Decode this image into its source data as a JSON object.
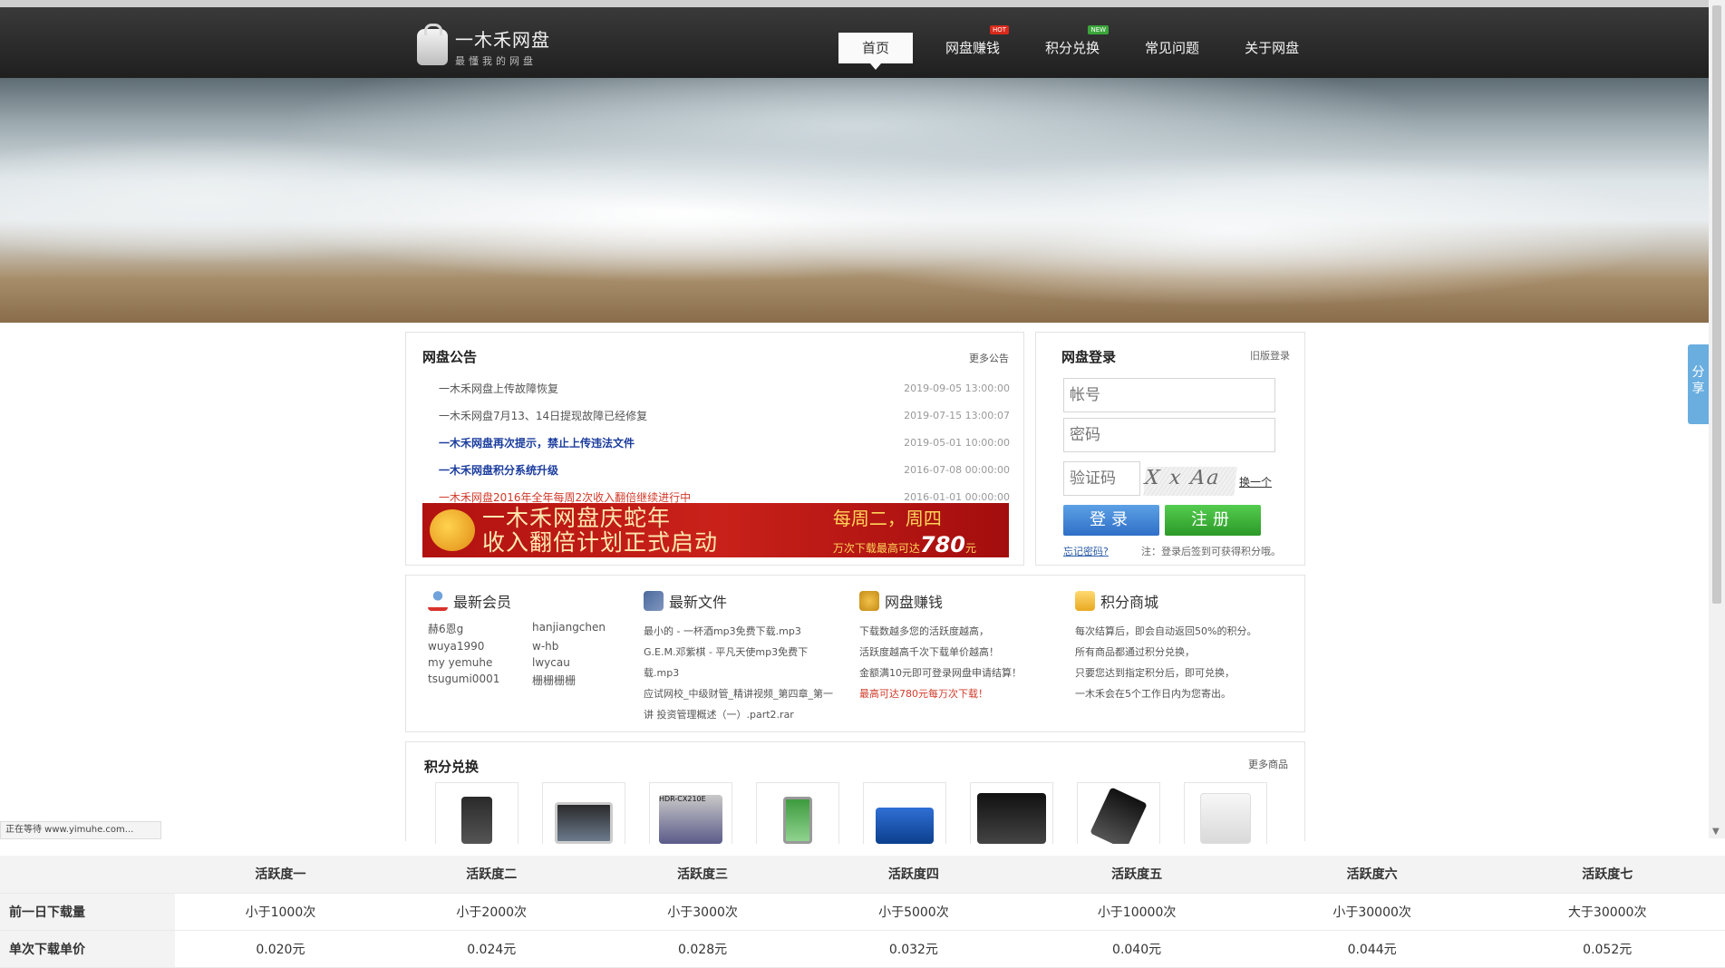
{
  "header": {
    "logo_title": "一木禾网盘",
    "logo_subtitle": "最懂我的网盘",
    "nav": [
      {
        "label": "首页",
        "active": true,
        "badge": ""
      },
      {
        "label": "网盘赚钱",
        "active": false,
        "badge": "HOT"
      },
      {
        "label": "积分兑换",
        "active": false,
        "badge": "NEW"
      },
      {
        "label": "常见问题",
        "active": false,
        "badge": ""
      },
      {
        "label": "关于网盘",
        "active": false,
        "badge": ""
      }
    ]
  },
  "share_tab": "分享",
  "notice": {
    "title": "网盘公告",
    "more": "更多公告",
    "items": [
      {
        "text": "一木禾网盘上传故障恢复",
        "date": "2019-09-05 13:00:00",
        "style": "gray"
      },
      {
        "text": "一木禾网盘7月13、14日提现故障已经修复",
        "date": "2019-07-15 13:00:07",
        "style": "gray"
      },
      {
        "text": "一木禾网盘再次提示，禁止上传违法文件",
        "date": "2019-05-01 10:00:00",
        "style": "blue"
      },
      {
        "text": "一木禾网盘积分系统升级",
        "date": "2016-07-08 00:00:00",
        "style": "blue"
      },
      {
        "text": "一木禾网盘2016年全年每周2次收入翻倍继续进行中",
        "date": "2016-01-01 00:00:00",
        "style": "red"
      }
    ],
    "promo_main_line1": "一木禾网盘庆蛇年",
    "promo_main_line2": "收入翻倍计划正式启动",
    "promo_side_line1": "每周二，周四",
    "promo_side_line2": "万次下载最高可达",
    "promo_amount": "780",
    "promo_unit": "元"
  },
  "login": {
    "title": "网盘登录",
    "old_login": "旧版登录",
    "account_placeholder": "帐号",
    "password_placeholder": "密码",
    "captcha_placeholder": "验证码",
    "captcha_text": "X x Aa",
    "captcha_refresh": "换一个",
    "login_button": "登录",
    "register_button": "注册",
    "forgot": "忘记密码?",
    "note": "注：登录后签到可获得积分哦。"
  },
  "info": {
    "members": {
      "title": "最新会员",
      "names": [
        "赫6恩g",
        "hanjiangchen",
        "wuya1990",
        "w-hb",
        "my yemuhe",
        "lwycau",
        "tsugumi0001",
        "栅栅栅栅"
      ]
    },
    "files": {
      "title": "最新文件",
      "lines": [
        "最小的 - 一杯酒mp3免费下载.mp3",
        "G.E.M.邓紫棋 - 平凡天使mp3免费下",
        "载.mp3",
        "应试网校_中级财管_精讲视频_第四章_第一",
        "讲 投资管理概述（一）.part2.rar"
      ]
    },
    "earn": {
      "title": "网盘赚钱",
      "lines": [
        "下载数越多您的活跃度越高，",
        "活跃度越高千次下载单价越高！",
        "金额满10元即可登录网盘申请结算！"
      ],
      "highlight": "最高可达780元每万次下载！"
    },
    "mall": {
      "title": "积分商城",
      "lines": [
        "每次结算后，即会自动返回50%的积分。",
        "所有商品都通过积分兑换，",
        "只要您达到指定积分后，即可兑换，",
        "一木禾会在5个工作日内为您寄出。"
      ]
    }
  },
  "exchange": {
    "title": "积分兑换",
    "more": "更多商品",
    "products": [
      "iphone-icon",
      "ipad-icon",
      "camcorder-icon",
      "phone-icon",
      "camera-icon",
      "tv-box-icon",
      "hard-disk-icon",
      "router-icon"
    ],
    "camcorder_label": "HDR-CX210E"
  },
  "status_bar": "正在等待 www.yimuhe.com...",
  "rates": {
    "headers": [
      "活跃度一",
      "活跃度二",
      "活跃度三",
      "活跃度四",
      "活跃度五",
      "活跃度六",
      "活跃度七"
    ],
    "row1_label": "前一日下载量",
    "row1": [
      "小于1000次",
      "小于2000次",
      "小于3000次",
      "小于5000次",
      "小于10000次",
      "小于30000次",
      "大于30000次"
    ],
    "row2_label": "单次下载单价",
    "row2": [
      "0.020元",
      "0.024元",
      "0.028元",
      "0.032元",
      "0.040元",
      "0.044元",
      "0.052元"
    ]
  }
}
